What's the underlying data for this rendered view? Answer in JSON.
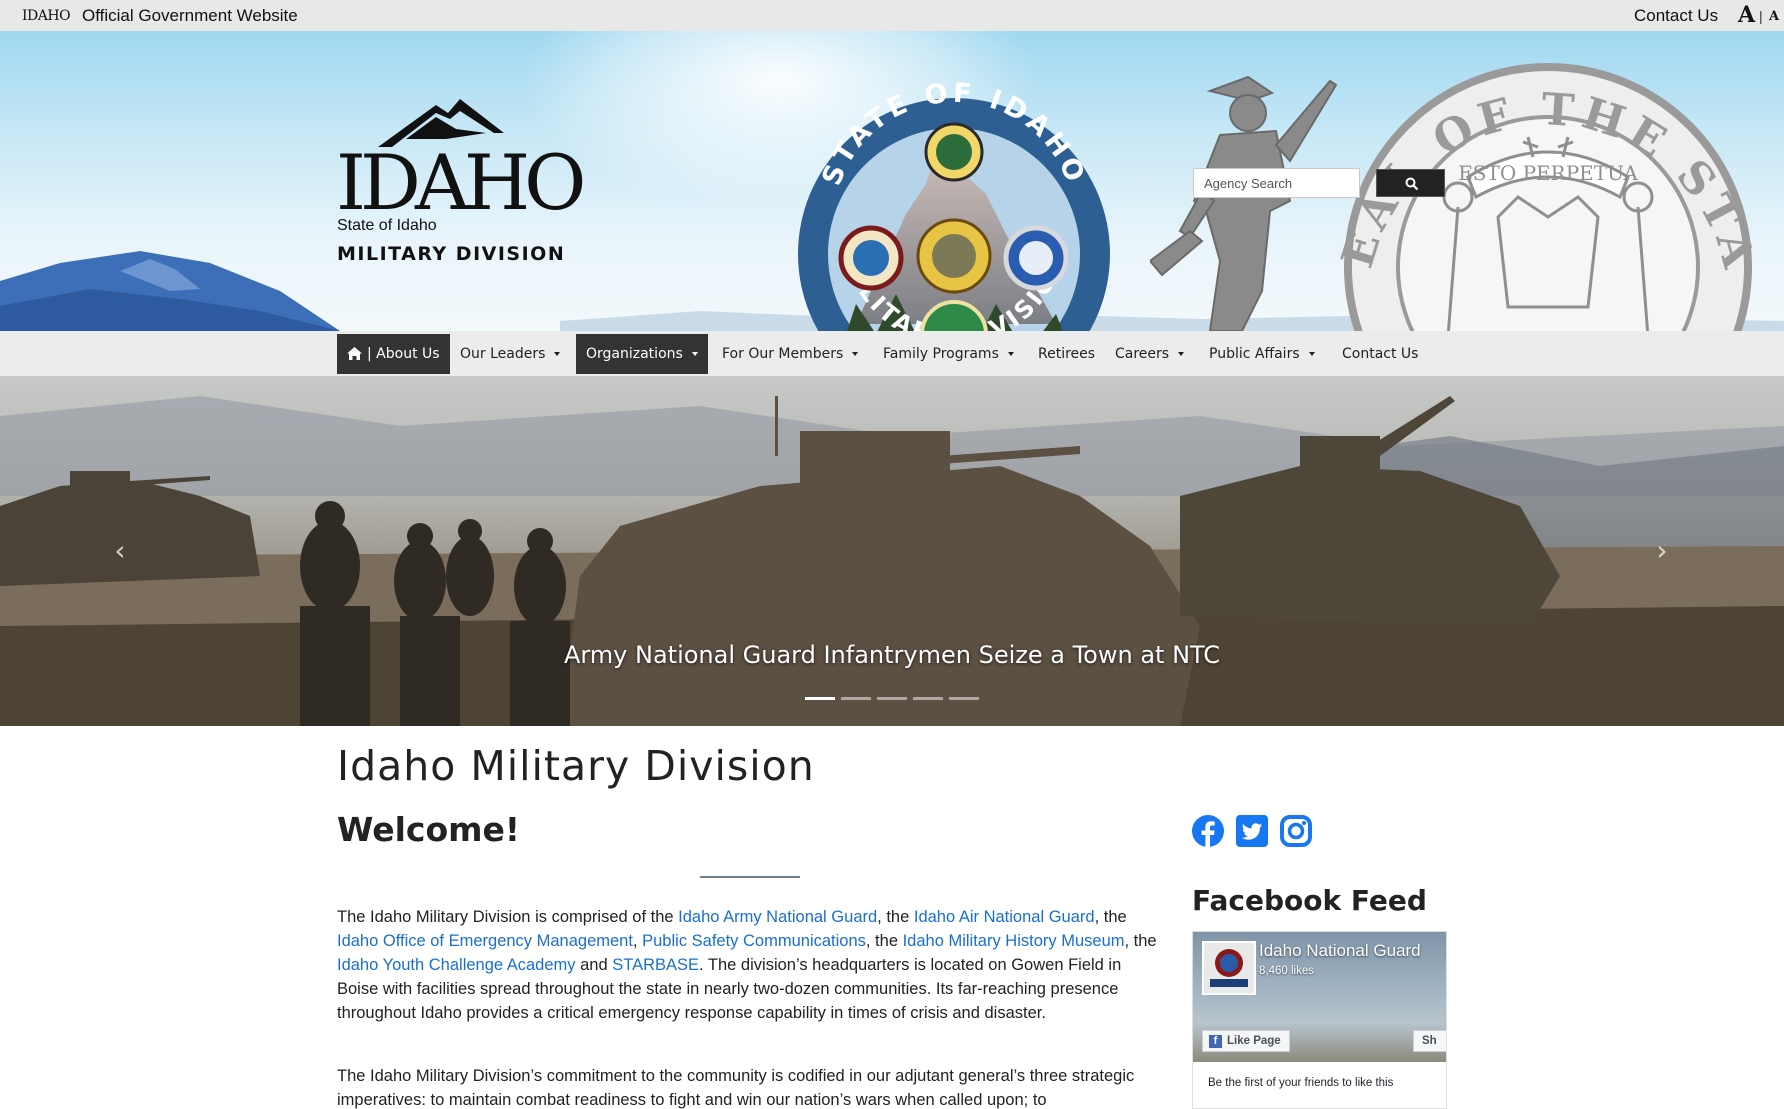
{
  "topbar": {
    "logo_text": "IDAHO",
    "official_text": "Official Government Website",
    "contact_label": "Contact Us",
    "font_increase": "A",
    "font_separator": "|",
    "font_decrease": "A"
  },
  "header": {
    "logo_word": "IDAHO",
    "state_line": "State of Idaho",
    "division_line": "MILITARY DIVISION",
    "seal_text_top": "STATE OF IDAHO",
    "seal_text_bottom": "MILITARY DIVISION",
    "great_seal_text": "THE GREAT SEAL OF THE STATE OF IDAHO",
    "motto": "ESTO PERPETUA",
    "search_placeholder": "Agency Search"
  },
  "nav": {
    "items": [
      {
        "label": "| About Us",
        "has_caret": false,
        "active": true
      },
      {
        "label": "Our Leaders",
        "has_caret": true,
        "active": false
      },
      {
        "label": "Organizations",
        "has_caret": true,
        "active": true
      },
      {
        "label": "For Our Members",
        "has_caret": true,
        "active": false
      },
      {
        "label": "Family Programs",
        "has_caret": true,
        "active": false
      },
      {
        "label": "Retirees",
        "has_caret": false,
        "active": false
      },
      {
        "label": "Careers",
        "has_caret": true,
        "active": false
      },
      {
        "label": "Public Affairs",
        "has_caret": true,
        "active": false
      },
      {
        "label": "Contact Us",
        "has_caret": false,
        "active": false
      }
    ]
  },
  "carousel": {
    "caption": "Army National Guard Infantrymen Seize a Town at NTC",
    "prev_arrow": "‹",
    "next_arrow": "›",
    "slide_count": 5,
    "active_slide": 1
  },
  "main": {
    "title": "Idaho Military Division",
    "welcome": "Welcome!",
    "para1": {
      "t1": "The Idaho Military Division is comprised of the ",
      "l1": "Idaho Army National Guard",
      "t2": ", the ",
      "l2": "Idaho Air National Guard",
      "t3": ", the ",
      "l3": "Idaho Office of Emergency Management",
      "t4": ", ",
      "l4": "Public Safety Communications",
      "t5": ", the ",
      "l5": "Idaho Military History Museum",
      "t6": ", the ",
      "l6": "Idaho Youth Challenge Academy",
      "t7": " and ",
      "l7": "STARBASE",
      "t8": ". The division’s headquarters is located on Gowen Field in Boise with facilities spread throughout the state in nearly two-dozen communities. Its far-reaching presence throughout Idaho provides a critical emergency response capability in times of crisis and disaster."
    },
    "para2": "The Idaho Military Division’s commitment to the community is codified in our adjutant general’s three strategic imperatives: to maintain combat readiness to fight and win our nation’s wars when called upon; to"
  },
  "sidebar": {
    "social_icons": [
      "facebook-icon",
      "twitter-icon",
      "instagram-icon"
    ],
    "facebook_feed_title": "Facebook Feed",
    "fb_page_name": "Idaho National Guard",
    "fb_likes": "8,460 likes",
    "fb_like_button": "Like Page",
    "fb_share_button": "Sh",
    "fb_first_text": "Be the first of your friends to like this"
  },
  "colors": {
    "link": "#1a6fd0",
    "nav_active_bg": "#333333",
    "topbar_bg": "#e8e8e8",
    "nav_bg": "#ececec",
    "social_blue": "#1877f2"
  }
}
